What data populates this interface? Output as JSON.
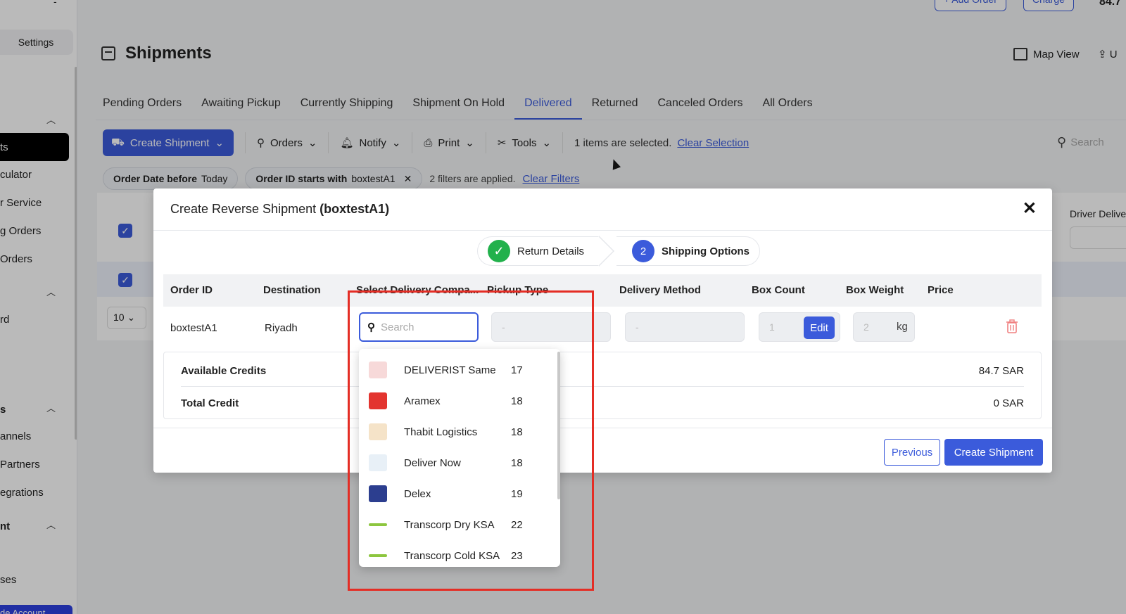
{
  "sidebar": {
    "top_dash": "-",
    "settings": "Settings",
    "items": [
      {
        "label": "ts"
      },
      {
        "label": "culator"
      },
      {
        "label": "r Service"
      },
      {
        "label": "g Orders"
      },
      {
        "label": "Orders"
      },
      {
        "label": "rd"
      },
      {
        "label": "annels"
      },
      {
        "label": "Partners"
      },
      {
        "label": "egrations"
      },
      {
        "label": "ses"
      }
    ],
    "sections": [
      {
        "label": "s"
      },
      {
        "label": "nt"
      }
    ],
    "upgrade": "de Account"
  },
  "top": {
    "add_order": "+ Add Order",
    "charge": "Charge",
    "balance": "84.7"
  },
  "page": {
    "title": "Shipments",
    "map_view": "Map View",
    "upload_cut": "U"
  },
  "tabs": [
    {
      "label": "Pending Orders",
      "active": false
    },
    {
      "label": "Awaiting Pickup",
      "active": false
    },
    {
      "label": "Currently Shipping",
      "active": false
    },
    {
      "label": "Shipment On Hold",
      "active": false
    },
    {
      "label": "Delivered",
      "active": true
    },
    {
      "label": "Returned",
      "active": false
    },
    {
      "label": "Canceled Orders",
      "active": false
    },
    {
      "label": "All Orders",
      "active": false
    }
  ],
  "toolbar": {
    "create_shipment": "Create Shipment",
    "orders": "Orders",
    "notify": "Notify",
    "print": "Print",
    "tools": "Tools",
    "selection_info": "1 items are selected.",
    "clear_selection": "Clear Selection",
    "search_placeholder": "Search"
  },
  "filters": {
    "chip1_key": "Order Date before",
    "chip1_val": "Today",
    "chip2_key": "Order ID starts with",
    "chip2_val": "boxtestA1",
    "info": "2 filters are applied.",
    "clear": "Clear Filters"
  },
  "background_table": {
    "driver_col": "Driver Delive",
    "page_size": "10"
  },
  "modal": {
    "title": "Create Reverse Shipment",
    "title_id": "(boxtestA1)",
    "steps": [
      {
        "label": "Return Details",
        "state": "done"
      },
      {
        "num": "2",
        "label": "Shipping Options",
        "state": "current"
      }
    ],
    "columns": [
      "Order ID",
      "Destination",
      "Select Delivery Compa...",
      "Pickup Type",
      "Delivery Method",
      "Box Count",
      "Box Weight",
      "Price"
    ],
    "row": {
      "order_id": "boxtestA1",
      "destination": "Riyadh",
      "search_placeholder": "Search",
      "pickup_type": "-",
      "delivery_method": "-",
      "box_count": "1",
      "edit": "Edit",
      "box_weight": "2",
      "weight_unit": "kg"
    },
    "credits": [
      {
        "label": "Available Credits",
        "value": "84.7 SAR"
      },
      {
        "label": "Total Credit",
        "value": "0 SAR"
      }
    ],
    "btn_previous": "Previous",
    "btn_create": "Create Shipment"
  },
  "dropdown": {
    "options": [
      {
        "name": "DELIVERIST Same ...",
        "days": "17",
        "color": "#f7d9d9"
      },
      {
        "name": "Aramex",
        "days": "18",
        "color": "#e3342f"
      },
      {
        "name": "Thabit Logistics",
        "days": "18",
        "color": "#f5e3c8"
      },
      {
        "name": "Deliver Now",
        "days": "18",
        "color": "#e8f0f7"
      },
      {
        "name": "Delex",
        "days": "19",
        "color": "#2c3e8f"
      },
      {
        "name": "Transcorp Dry KSA",
        "days": "22",
        "color": "#8dc63f"
      },
      {
        "name": "Transcorp Cold KSA",
        "days": "23",
        "color": "#8dc63f"
      }
    ]
  },
  "colors": {
    "accent": "#3b5bdb",
    "success": "#22b14c",
    "highlight": "#e42d25"
  }
}
